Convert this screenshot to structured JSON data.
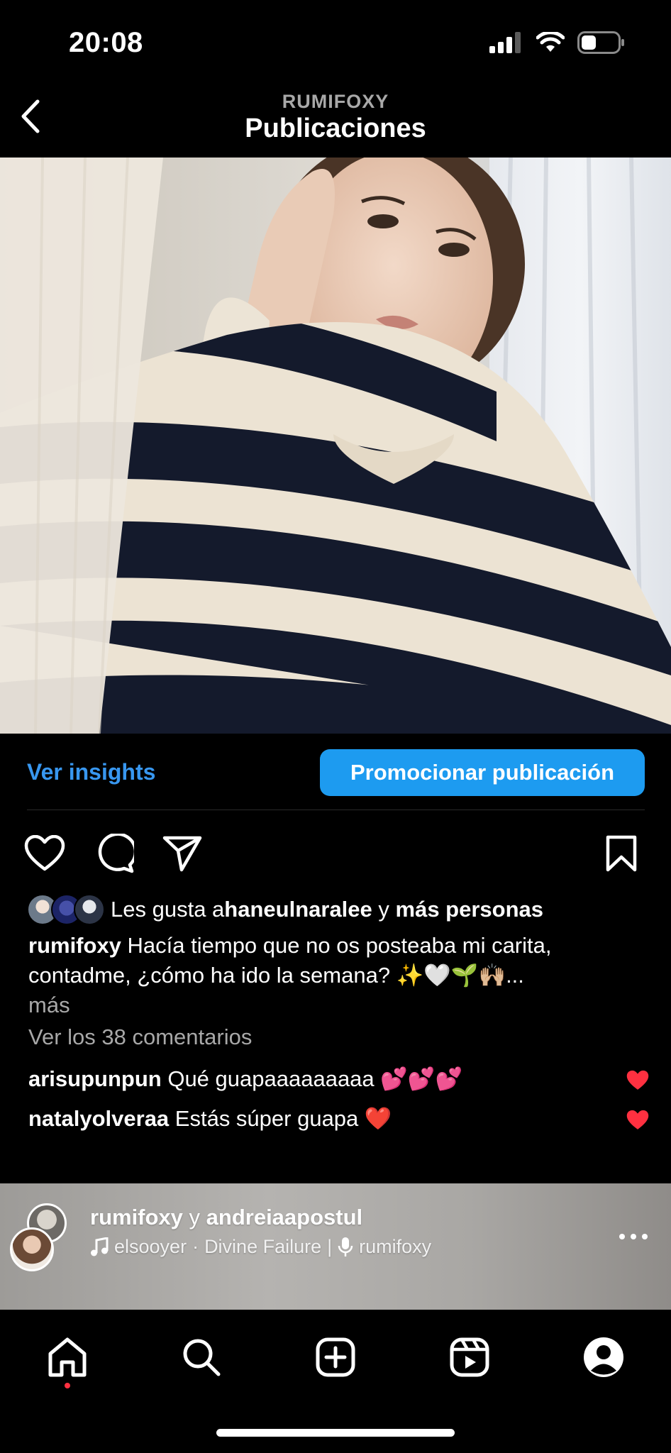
{
  "status_bar": {
    "time": "20:08",
    "battery_level": 0.4
  },
  "header": {
    "subtitle": "RUMIFOXY",
    "title": "Publicaciones"
  },
  "insights": {
    "link": "Ver insights",
    "promote": "Promocionar publicación"
  },
  "likes": {
    "prefix": "Les gusta a ",
    "user": "haneulnaralee",
    "middle": " y ",
    "others": "más personas"
  },
  "caption": {
    "username": "rumifoxy",
    "text": " Hacía tiempo que no os posteaba mi carita, contadme, ¿cómo ha ido la semana? ✨🤍🌱🙌🏼...",
    "more": "más"
  },
  "comments": {
    "view_all": "Ver los 38 comentarios",
    "items": [
      {
        "user": "arisupunpun",
        "text": " Qué guapaaaaaaaaa 💕💕💕"
      },
      {
        "user": "natalyolveraa",
        "text": " Estás súper guapa ❤️"
      }
    ]
  },
  "next_post": {
    "user1": "rumifoxy",
    "joiner": " y ",
    "user2": "andreiaapostul",
    "audio_artist": "elsooyer",
    "audio_separator": "·",
    "audio_track": "Divine Failure",
    "audio_divider": "|",
    "audio_original": "rumifoxy"
  },
  "icons": {
    "back": "chevron-left-icon",
    "like": "heart-outline-icon",
    "comment": "comment-bubble-icon",
    "share": "paper-plane-icon",
    "save": "bookmark-icon",
    "nav": [
      "home-icon",
      "search-icon",
      "create-plus-icon",
      "reels-icon",
      "profile-icon"
    ]
  },
  "colors": {
    "accent": "#1d9bf0",
    "link": "#3897f0",
    "like_red": "#ff3040",
    "muted": "#a8a8a8"
  }
}
